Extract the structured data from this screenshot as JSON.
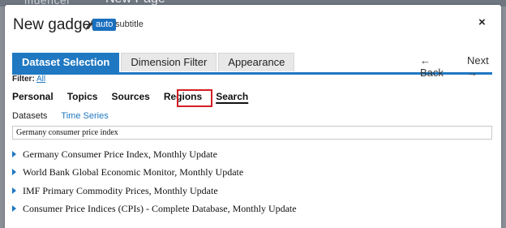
{
  "background": {
    "left_text": "ifluencer",
    "right_text": "New Page"
  },
  "header": {
    "title": "New gadget",
    "auto_badge": "auto",
    "subtitle": "subtitle",
    "close_label": "×"
  },
  "tabs": [
    {
      "label": "Dataset Selection",
      "active": true
    },
    {
      "label": "Dimension Filter",
      "active": false
    },
    {
      "label": "Appearance",
      "active": false
    }
  ],
  "nav": {
    "back_label": "← Back",
    "next_label": "Next →"
  },
  "filter": {
    "label": "Filter:",
    "value": "All"
  },
  "categories": [
    "Personal",
    "Topics",
    "Sources",
    "Regions",
    "Search"
  ],
  "selected_category": "Search",
  "sub_tabs": [
    "Datasets",
    "Time Series"
  ],
  "search": {
    "value": "Germany consumer price index"
  },
  "results": [
    "Germany Consumer Price Index, Monthly Update",
    "World Bank Global Economic Monitor, Monthly Update",
    "IMF Primary Commodity Prices, Monthly Update",
    "Consumer Price Indices (CPIs) - Complete Database, Monthly Update"
  ],
  "colors": {
    "accent": "#1f78c1",
    "highlight_box": "#d21e25"
  }
}
